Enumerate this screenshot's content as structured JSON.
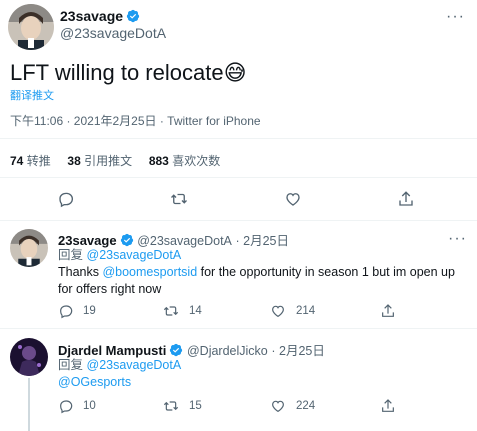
{
  "main_tweet": {
    "author_name": "23savage",
    "author_handle": "@23savageDotA",
    "text": "LFT willing to relocate",
    "emoji": "😅",
    "translate_label": "翻译推文",
    "timestamp": "下午11:06 · 2021年2月25日 · Twitter for iPhone",
    "stats": {
      "retweets_count": "74",
      "retweets_label": "转推",
      "quotes_count": "38",
      "quotes_label": "引用推文",
      "likes_count": "883",
      "likes_label": "喜欢次数"
    },
    "actions": [
      "reply-icon",
      "retweet-icon",
      "like-icon",
      "share-icon"
    ]
  },
  "replies": [
    {
      "author_name": "23savage",
      "author_handle": "@23savageDotA",
      "date": "· 2月25日",
      "reply_to_label": "回复",
      "reply_to_handle": "@23savageDotA",
      "text_prefix": "Thanks ",
      "mention": "@boomesportsid",
      "text_suffix": " for the opportunity in season 1 but im open up for offers right now",
      "replies": "19",
      "retweets": "14",
      "likes": "214"
    },
    {
      "author_name": "Djardel Mampusti",
      "author_handle": "@DjardelJicko",
      "date": "· 2月25日",
      "reply_to_label": "回复",
      "reply_to_handle": "@23savageDotA",
      "mention_line": "@OGesports",
      "replies": "10",
      "retweets": "15",
      "likes": "224"
    }
  ],
  "colors": {
    "accent": "#1d9bf0",
    "text": "#0f1419",
    "secondary": "#536471",
    "divider": "#eff3f4"
  }
}
